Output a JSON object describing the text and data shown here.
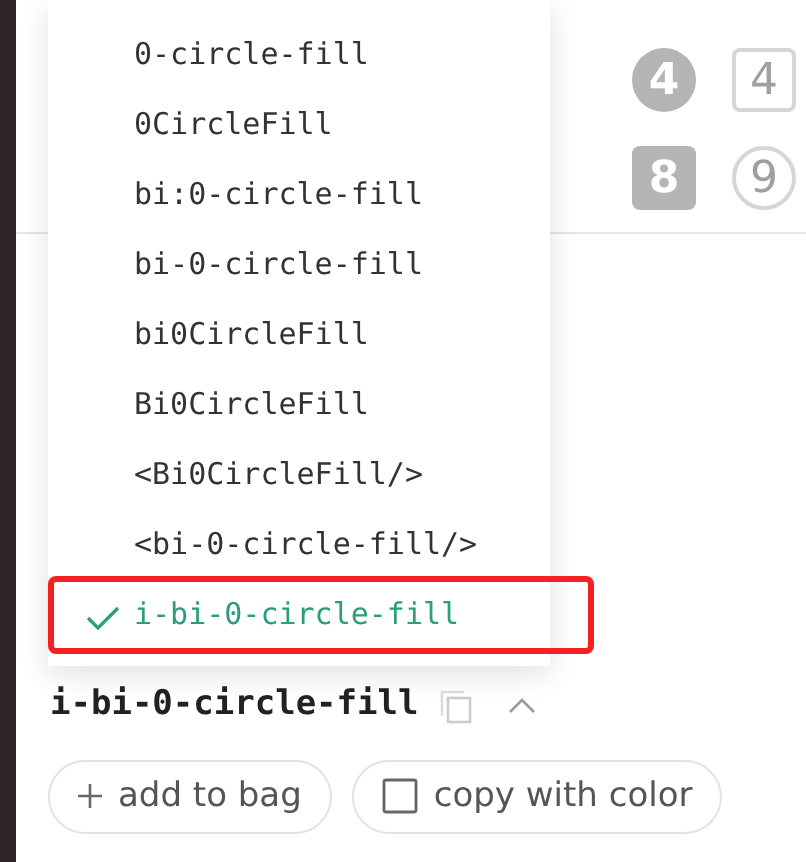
{
  "icon_grid": [
    {
      "kind": "circle-fill",
      "glyph": "4"
    },
    {
      "kind": "square",
      "glyph": "4"
    },
    {
      "kind": "square-fill",
      "glyph": "8"
    },
    {
      "kind": "circle",
      "glyph": "9"
    }
  ],
  "menu": {
    "items": [
      {
        "label": "0-circle-fill",
        "selected": false,
        "highlighted": false
      },
      {
        "label": "0CircleFill",
        "selected": false,
        "highlighted": false
      },
      {
        "label": "bi:0-circle-fill",
        "selected": false,
        "highlighted": false
      },
      {
        "label": "bi-0-circle-fill",
        "selected": false,
        "highlighted": false
      },
      {
        "label": "bi0CircleFill",
        "selected": false,
        "highlighted": false
      },
      {
        "label": "Bi0CircleFill",
        "selected": false,
        "highlighted": false
      },
      {
        "label": "<Bi0CircleFill/>",
        "selected": false,
        "highlighted": false
      },
      {
        "label": "<bi-0-circle-fill/>",
        "selected": false,
        "highlighted": false
      },
      {
        "label": "i-bi-0-circle-fill",
        "selected": true,
        "highlighted": true
      }
    ]
  },
  "icon_name": "i-bi-0-circle-fill",
  "expanded": true,
  "buttons": [
    {
      "kind": "add",
      "label": "add to bag"
    },
    {
      "kind": "checkbox",
      "label": "copy with color",
      "checked": false
    }
  ]
}
